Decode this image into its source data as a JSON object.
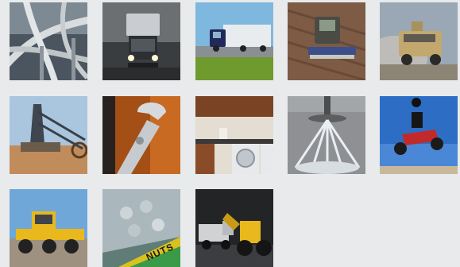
{
  "gallery": {
    "tiles": [
      {
        "name": "highway-interchange"
      },
      {
        "name": "semi-truck-headlights"
      },
      {
        "name": "semi-truck-highway"
      },
      {
        "name": "combine-harvester"
      },
      {
        "name": "military-humvee"
      },
      {
        "name": "bucket-wheel-excavator"
      },
      {
        "name": "adjustable-wrench"
      },
      {
        "name": "laundry-room"
      },
      {
        "name": "fire-sprinkler"
      },
      {
        "name": "atv-jump"
      },
      {
        "name": "motor-grader"
      },
      {
        "name": "nuts-hardware-bin"
      },
      {
        "name": "wheel-loader-dump-truck"
      }
    ],
    "nuts_bin_label": "NUTS"
  },
  "colors": {
    "page_background": "#e8eaec",
    "caterpillar_yellow": "#e8b81c",
    "sky_blue": "#6fa8d8"
  }
}
